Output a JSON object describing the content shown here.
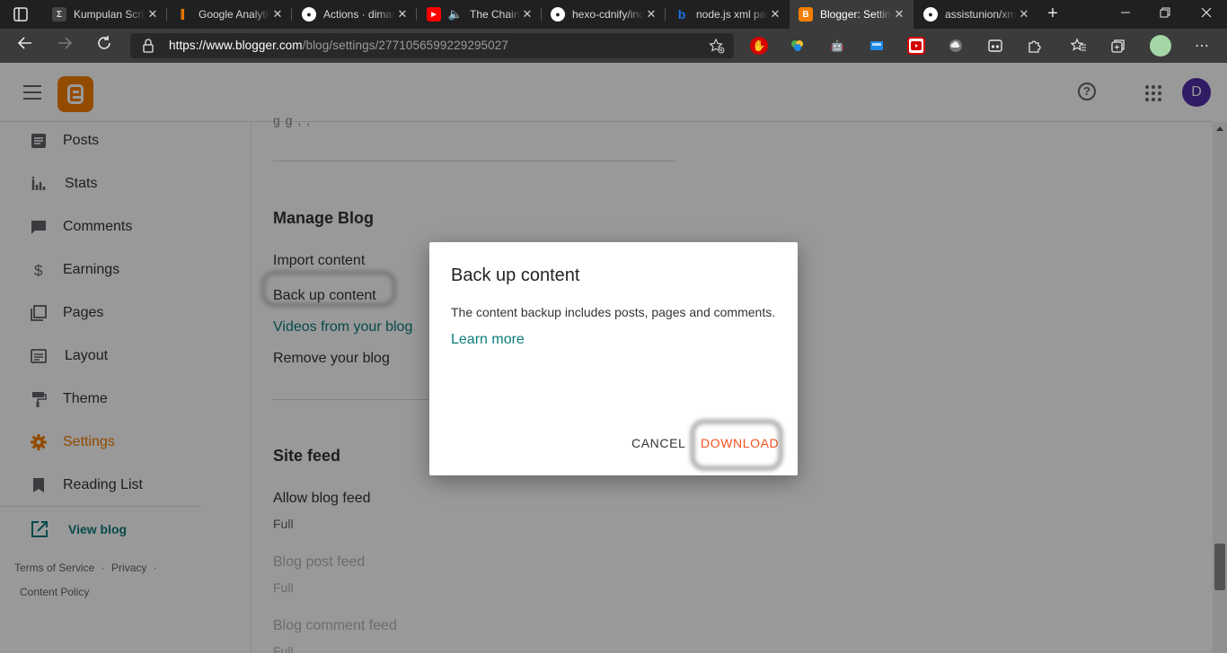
{
  "browser": {
    "tabs": [
      {
        "title": "Kumpulan Script",
        "favicon": "Σ",
        "color": "#5a5a5a"
      },
      {
        "title": "Google Analytics",
        "favicon": "▌",
        "color": "#e37400"
      },
      {
        "title": "Actions · dimaslanjaka",
        "favicon": "●",
        "color": "#ffffff"
      },
      {
        "title": "The Chainsmokers",
        "favicon": "▶",
        "color": "#ff0000"
      },
      {
        "title": "hexo-cdnify/index",
        "favicon": "●",
        "color": "#ffffff"
      },
      {
        "title": "node.js xml parse",
        "favicon": "b",
        "color": "#1a73e8"
      },
      {
        "title": "Blogger: Settings",
        "favicon": "B",
        "color": "#f57d00"
      },
      {
        "title": "assistunion/xml",
        "favicon": "●",
        "color": "#ffffff"
      }
    ],
    "close_glyph": "✕",
    "url_host": "https://www.blogger.com",
    "url_path": "/blog/settings/2771056599229295027"
  },
  "app": {
    "avatar_letter": "D",
    "help_glyph": "?",
    "sidebar": {
      "items": [
        {
          "label": "Posts",
          "icon": "posts-icon"
        },
        {
          "label": "Stats",
          "icon": "stats-icon"
        },
        {
          "label": "Comments",
          "icon": "comments-icon"
        },
        {
          "label": "Earnings",
          "icon": "dollar-icon"
        },
        {
          "label": "Pages",
          "icon": "pages-icon"
        },
        {
          "label": "Layout",
          "icon": "layout-icon"
        },
        {
          "label": "Theme",
          "icon": "paint-roller-icon"
        },
        {
          "label": "Settings",
          "icon": "gear-icon"
        },
        {
          "label": "Reading List",
          "icon": "bookmark-icon"
        }
      ],
      "view_blog": "View blog",
      "footer": {
        "terms": "Terms of Service",
        "privacy": "Privacy",
        "dot": "·",
        "content_policy": "Content Policy"
      }
    },
    "main": {
      "manage_blog": {
        "title": "Manage Blog",
        "import": "Import content",
        "backup": "Back up content",
        "videos": "Videos from your blog",
        "remove": "Remove your blog"
      },
      "site_feed": {
        "title": "Site feed",
        "allow_blog_feed": "Allow blog feed",
        "allow_blog_feed_value": "Full",
        "blog_post_feed": "Blog post feed",
        "blog_post_feed_value": "Full",
        "blog_comment_feed": "Blog comment feed",
        "blog_comment_feed_value": "Full"
      }
    },
    "dialog": {
      "title": "Back up content",
      "body": "The content backup includes posts, pages and comments.",
      "learn_more": "Learn more",
      "cancel": "CANCEL",
      "download": "DOWNLOAD"
    },
    "colors": {
      "brand": "#f57d00",
      "link": "#0b7c7c",
      "download": "#f4511e"
    }
  }
}
